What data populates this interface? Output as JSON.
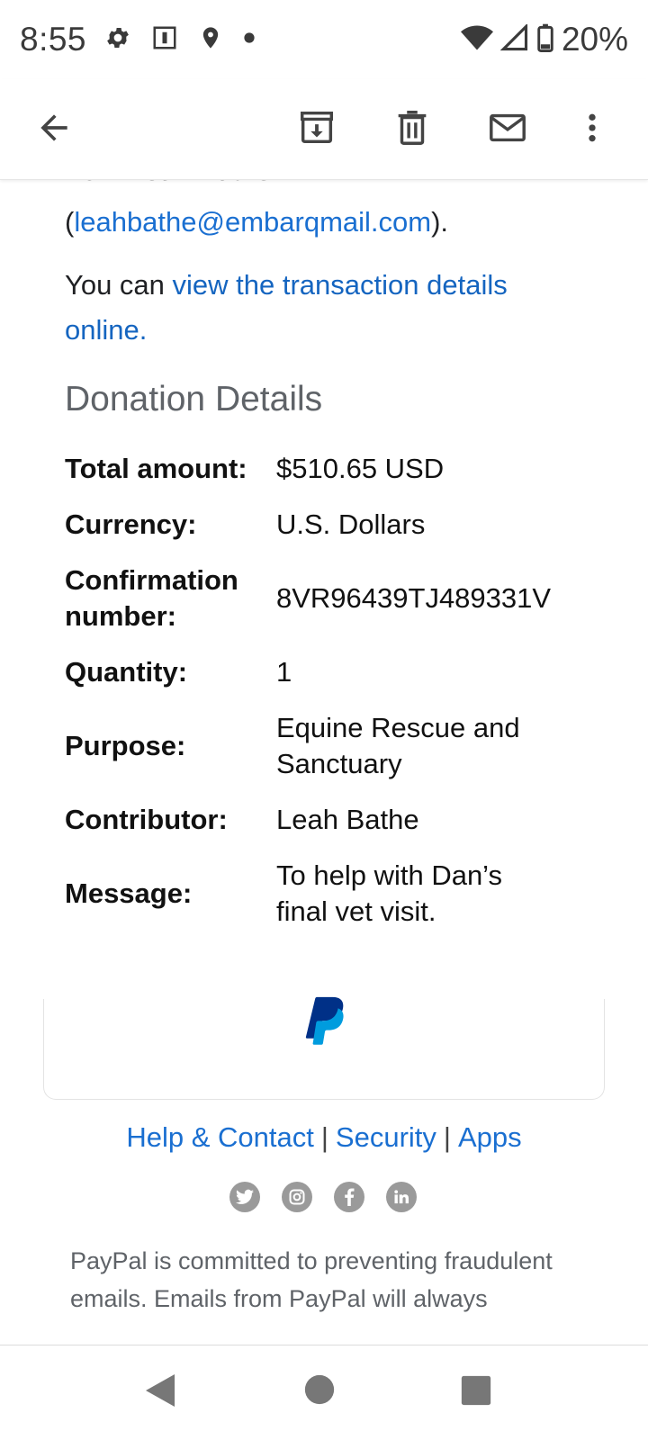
{
  "status_bar": {
    "time": "8:55",
    "battery": "20%",
    "icons_left": [
      "gear-icon",
      "sim-icon",
      "location-icon",
      "dot-icon"
    ],
    "icons_right": [
      "wifi-icon",
      "signal-icon",
      "battery-icon"
    ]
  },
  "app_bar": {
    "icons": [
      "back-arrow-icon",
      "archive-icon",
      "delete-icon",
      "mark-unread-icon",
      "more-vert-icon"
    ]
  },
  "email": {
    "clipped_line": "from Leah Bathe",
    "sender_email_prefix": "(",
    "sender_email": "leahbathe@embarqmail.com",
    "sender_email_suffix": ").",
    "view_prefix": "You can ",
    "view_link": "view the transaction details online.",
    "section_title": "Donation Details",
    "details": [
      {
        "label": "Total amount:",
        "value": "$510.65 USD"
      },
      {
        "label": "Currency:",
        "value": "U.S. Dollars"
      },
      {
        "label": "Confirmation number:",
        "value": "8VR96439TJ489331V"
      },
      {
        "label": "Quantity:",
        "value": "1"
      },
      {
        "label": "Purpose:",
        "value": "Equine Rescue and Sanctuary"
      },
      {
        "label": "Contributor:",
        "value": "Leah Bathe"
      },
      {
        "label": "Message:",
        "value": "To help with Dan’s final vet visit."
      }
    ],
    "footer_links": [
      "Help & Contact",
      "Security",
      "Apps"
    ],
    "footer_separator": "|",
    "social_icons": [
      "twitter-icon",
      "instagram-icon",
      "facebook-icon",
      "linkedin-icon"
    ],
    "disclaimer": "PayPal is committed to preventing fraudulent emails. Emails from PayPal will always"
  },
  "colors": {
    "link": "#1a6fd1",
    "paypal_dark": "#003087",
    "paypal_light": "#009cde",
    "muted_text": "#5f6368"
  }
}
